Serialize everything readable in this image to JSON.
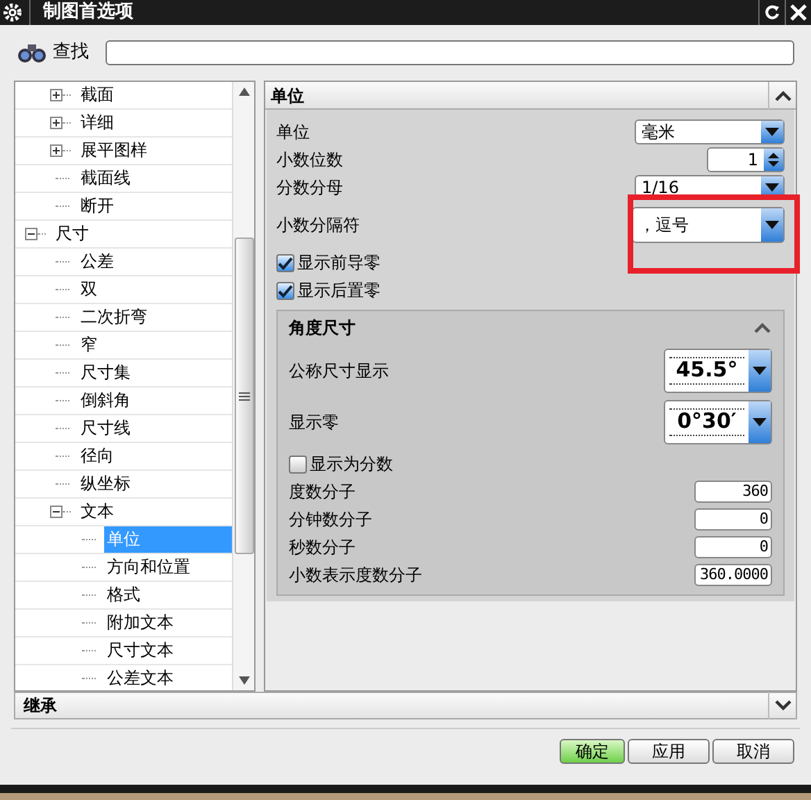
{
  "window": {
    "title": "制图首选项"
  },
  "search": {
    "label": "查找"
  },
  "tree": {
    "items": [
      {
        "children": [
          {
            "label": "截面",
            "expanded": false,
            "selected": false
          },
          {
            "label": "详细",
            "expanded": false,
            "selected": false
          },
          {
            "label": "展平图样",
            "expanded": false,
            "selected": false
          },
          {
            "label": "截面线",
            "selected": false
          },
          {
            "label": "断开",
            "selected": false
          }
        ]
      },
      {
        "label": "尺寸",
        "expanded": true,
        "selected": false,
        "children": [
          {
            "label": "公差",
            "selected": false
          },
          {
            "label": "双",
            "selected": false
          },
          {
            "label": "二次折弯",
            "selected": false
          },
          {
            "label": "窄",
            "selected": false
          },
          {
            "label": "尺寸集",
            "selected": false
          },
          {
            "label": "倒斜角",
            "selected": false
          },
          {
            "label": "尺寸线",
            "selected": false
          },
          {
            "label": "径向",
            "selected": false
          },
          {
            "label": "纵坐标",
            "selected": false
          },
          {
            "label": "文本",
            "expanded": true,
            "selected": false,
            "children": [
              {
                "label": "单位",
                "selected": true
              },
              {
                "label": "方向和位置",
                "selected": false
              },
              {
                "label": "格式",
                "selected": false
              },
              {
                "label": "附加文本",
                "selected": false
              },
              {
                "label": "尺寸文本",
                "selected": false
              },
              {
                "label": "公差文本",
                "selected": false
              }
            ]
          }
        ]
      }
    ]
  },
  "panel": {
    "title": "单位",
    "settings": [
      {
        "kind": "dropdown",
        "label": "单位",
        "value": "毫米"
      },
      {
        "kind": "spinner",
        "label": "小数位数",
        "value": "1"
      },
      {
        "kind": "dropdown",
        "label": "分数分母",
        "value": "1/16"
      },
      {
        "kind": "dropdown",
        "label": "小数分隔符",
        "value": "，逗号",
        "highlighted": true
      },
      {
        "kind": "checkbox",
        "label": "显示前导零",
        "checked": true
      },
      {
        "kind": "checkbox",
        "label": "显示后置零",
        "checked": true
      }
    ],
    "angle_section": {
      "title": "角度尺寸",
      "settings": [
        {
          "kind": "symbol",
          "label": "公称尺寸显示",
          "value": "45.5°"
        },
        {
          "kind": "symbol",
          "label": "显示零",
          "value": "0°30′"
        },
        {
          "kind": "checkbox",
          "label": "显示为分数",
          "checked": false
        },
        {
          "kind": "number",
          "label": "度数分子",
          "value": "360"
        },
        {
          "kind": "number",
          "label": "分钟数分子",
          "value": "0"
        },
        {
          "kind": "number",
          "label": "秒数分子",
          "value": "0"
        },
        {
          "kind": "number",
          "label": "小数表示度数分子",
          "value": "360.0000"
        }
      ]
    }
  },
  "inherit_section": {
    "title": "继承"
  },
  "buttons": [
    "确定",
    "应用",
    "取消"
  ]
}
